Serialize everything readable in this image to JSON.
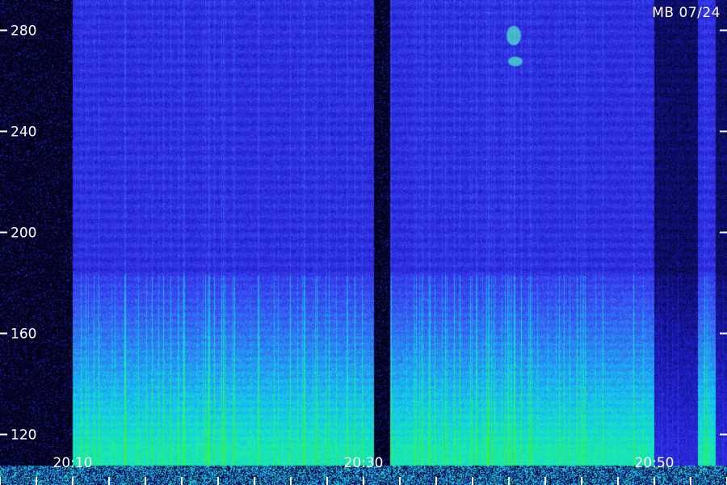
{
  "chart_data": {
    "type": "heatmap",
    "title": "",
    "xlabel": "",
    "ylabel": "",
    "stamp": "MB 07/24",
    "y_ticks": [
      {
        "value": 280,
        "label": "280"
      },
      {
        "value": 240,
        "label": "240"
      },
      {
        "value": 200,
        "label": "200"
      },
      {
        "value": 160,
        "label": "160"
      },
      {
        "value": 120,
        "label": "120"
      }
    ],
    "ylim": [
      100,
      292
    ],
    "x_ticks": [
      {
        "value": "20:10",
        "label": "20:10"
      },
      {
        "value": "20:30",
        "label": "20:30"
      },
      {
        "value": "20:50",
        "label": "20:50"
      }
    ],
    "xlim": [
      "20:05",
      "20:55"
    ],
    "colormap": [
      "#000000",
      "#0a0a55",
      "#1d1dc8",
      "#3a3af0",
      "#2f7cf2",
      "#12c8f0",
      "#19f0a0",
      "#44f02a"
    ],
    "gaps": [
      {
        "start": "20:05",
        "end": "20:10",
        "note": "no data"
      },
      {
        "start": "20:30.7",
        "end": "20:31.8",
        "note": "no data"
      },
      {
        "start": "20:50",
        "end": "20:53",
        "note": "low signal"
      },
      {
        "start": "20:54.2",
        "end": "20:55",
        "note": "low signal"
      }
    ]
  }
}
